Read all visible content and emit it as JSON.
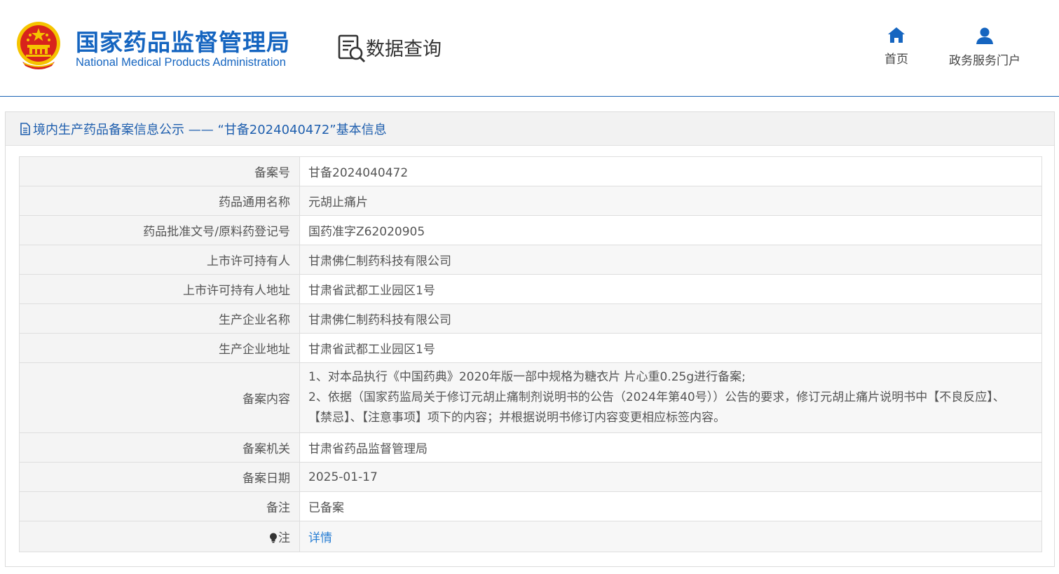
{
  "header": {
    "brand_cn": "国家药品监督管理局",
    "brand_en": "National Medical Products Administration",
    "query_title": "数据查询",
    "nav": [
      {
        "label": "首页",
        "icon": "home-icon"
      },
      {
        "label": "政务服务门户",
        "icon": "user-icon"
      }
    ]
  },
  "panel": {
    "title": "境内生产药品备案信息公示 —— “甘备2024040472”基本信息"
  },
  "record": {
    "rows": [
      {
        "label": "备案号",
        "value": "甘备2024040472"
      },
      {
        "label": "药品通用名称",
        "value": "元胡止痛片"
      },
      {
        "label": "药品批准文号/原料药登记号",
        "value": "国药准字Z62020905"
      },
      {
        "label": "上市许可持有人",
        "value": "甘肃佛仁制药科技有限公司"
      },
      {
        "label": "上市许可持有人地址",
        "value": "甘肃省武都工业园区1号"
      },
      {
        "label": "生产企业名称",
        "value": "甘肃佛仁制药科技有限公司"
      },
      {
        "label": "生产企业地址",
        "value": "甘肃省武都工业园区1号"
      }
    ],
    "content": {
      "label": "备案内容",
      "line1": "1、对本品执行《中国药典》2020年版一部中规格为糖衣片 片心重0.25g进行备案;",
      "line2": "2、依据（国家药监局关于修订元胡止痛制剂说明书的公告（2024年第40号））公告的要求，修订元胡止痛片说明书中【不良反应】、【禁忌】、【注意事项】项下的内容；并根据说明书修订内容变更相应标签内容。"
    },
    "rows2": [
      {
        "label": "备案机关",
        "value": "甘肃省药品监督管理局"
      },
      {
        "label": "备案日期",
        "value": "2025-01-17"
      },
      {
        "label": "备注",
        "value": "已备案"
      }
    ],
    "note": {
      "label": "注",
      "link": "详情"
    }
  },
  "colors": {
    "brand_blue": "#1565c0",
    "title_blue": "#1f5fae",
    "link_blue": "#2a7fd4",
    "emblem_red": "#d8241c",
    "emblem_gold": "#f5c400"
  }
}
